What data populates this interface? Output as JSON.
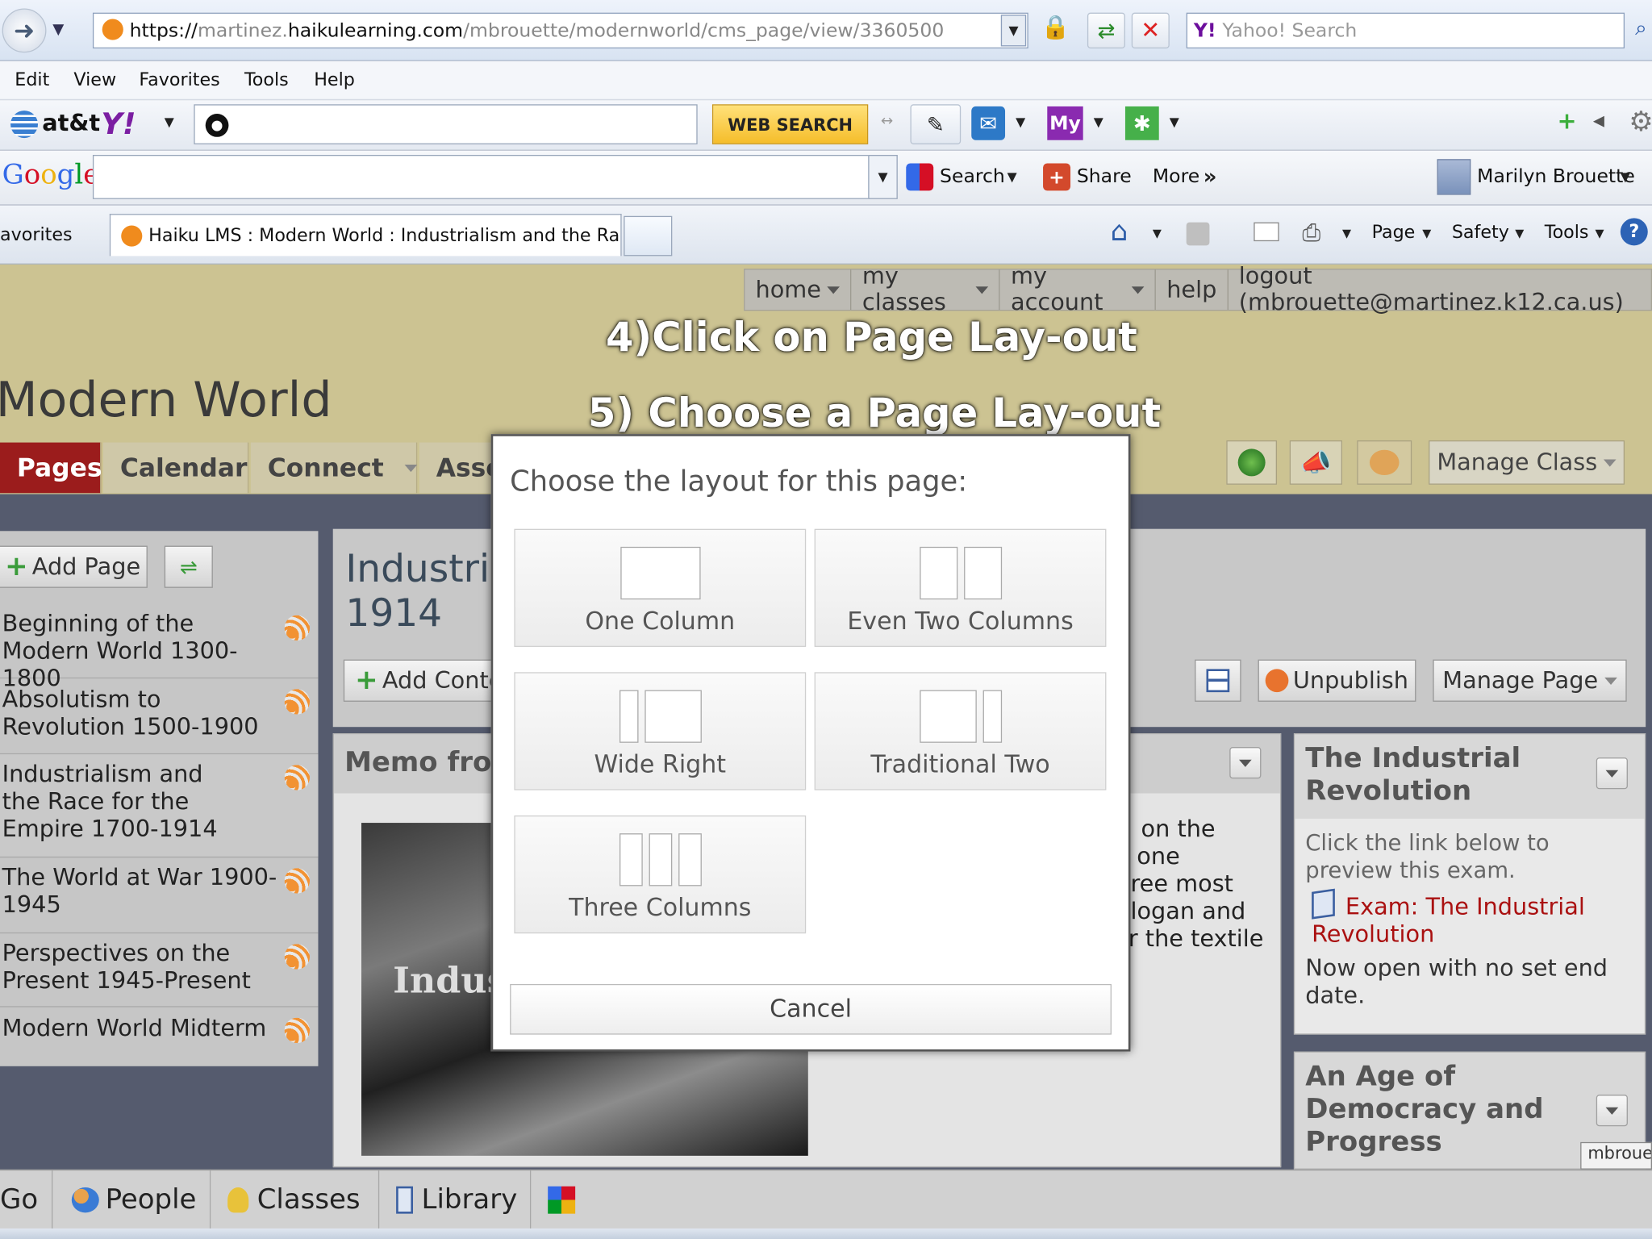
{
  "browser": {
    "url_prefix": "https://",
    "url_rest1": "martinez.",
    "url_domain": "haikulearning.com",
    "url_path": "/mbrouette/modernworld/cms_page/view/3360500",
    "search_placeholder": "Yahoo! Search",
    "menu": [
      "Edit",
      "View",
      "Favorites",
      "Tools",
      "Help"
    ],
    "att_label": "at&t",
    "web_search_label": "WEB SEARCH",
    "google_label": "Google",
    "google_search_label": "Search",
    "share_label": "Share",
    "more_label": "More",
    "user_name": "Marilyn Brouette",
    "favorites_label": "avorites",
    "tab_title": "Haiku LMS : Modern World : Industrialism and the Rac...",
    "cmd_page": "Page",
    "cmd_safety": "Safety",
    "cmd_tools": "Tools"
  },
  "site_nav": {
    "home": "home",
    "my_classes": "my classes",
    "my_account": "my account",
    "help": "help",
    "logout": "logout (mbrouette@martinez.k12.ca.us)"
  },
  "overlay": {
    "step4": "4)Click on Page Lay-out",
    "step5": "5) Choose a Page Lay-out"
  },
  "class_title": "Modern World",
  "class_tabs": [
    "Pages",
    "Calendar",
    "Connect",
    "Asse"
  ],
  "manage_class_label": "Manage Class",
  "sidebar": {
    "add_page_label": "Add Page",
    "items": [
      "Beginning of the Modern World 1300-1800",
      "Absolutism to Revolution 1500-1900",
      "Industrialism and the Race for the Empire 1700-1914",
      "The World at War 1900-1945",
      "Perspectives on the Present 1945-Present",
      "Modern World Midterm"
    ]
  },
  "main": {
    "title_line1": "Industrial",
    "title_line2": "1914",
    "add_content_label": "Add Conte",
    "unpublish_label": "Unpublish",
    "manage_page_label": "Manage Page",
    "memo_title": "Memo from",
    "photo_text": "Indus",
    "memo_fragments": [
      "on the",
      "one",
      "ree most",
      "logan and",
      "r the textile"
    ]
  },
  "right_panels": {
    "panel1_title": "The Industrial Revolution",
    "panel1_intro": "Click the link below to preview this exam.",
    "panel1_link": "Exam: The Industrial Revolution",
    "panel1_status": "Now open with no set end date.",
    "panel2_title": "An Age of Democracy and Progress",
    "username_tag": "mbrouet"
  },
  "dialog": {
    "prompt": "Choose the layout for this page:",
    "options": [
      "One Column",
      "Even Two Columns",
      "Wide Right",
      "Traditional Two",
      "Three Columns"
    ],
    "cancel_label": "Cancel"
  },
  "bottom_bar": [
    "Go",
    "People",
    "Classes",
    "Library"
  ],
  "colors": {
    "haiku_header": "#ccc392",
    "active_tab": "#9b1c1c",
    "link_red": "#a11",
    "overlay_text": "#ffffff"
  }
}
